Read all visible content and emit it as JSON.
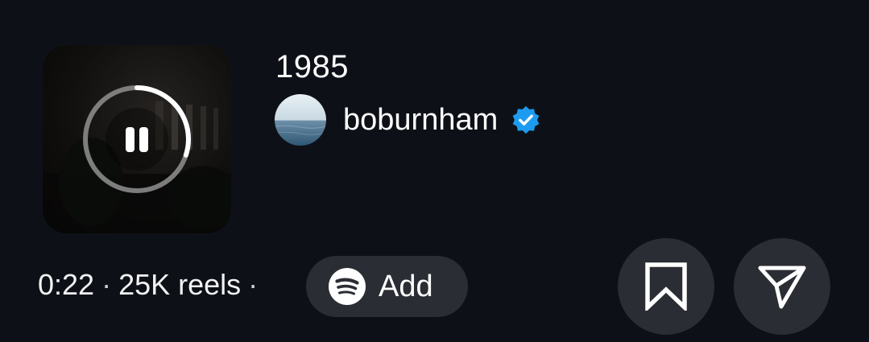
{
  "track": {
    "title": "1985",
    "progress": 0.3
  },
  "artist": {
    "name": "boburnham",
    "verified": true,
    "verified_color": "#1d9bf0"
  },
  "meta": {
    "duration": "0:22",
    "separator": "·",
    "reels": "25K reels"
  },
  "add_button": {
    "label": "Add",
    "icon": "spotify-icon"
  },
  "actions": {
    "save_icon": "bookmark-icon",
    "share_icon": "send-icon"
  },
  "colors": {
    "background": "#0d1117",
    "pill": "#2a2d33",
    "accent": "#1d9bf0"
  }
}
